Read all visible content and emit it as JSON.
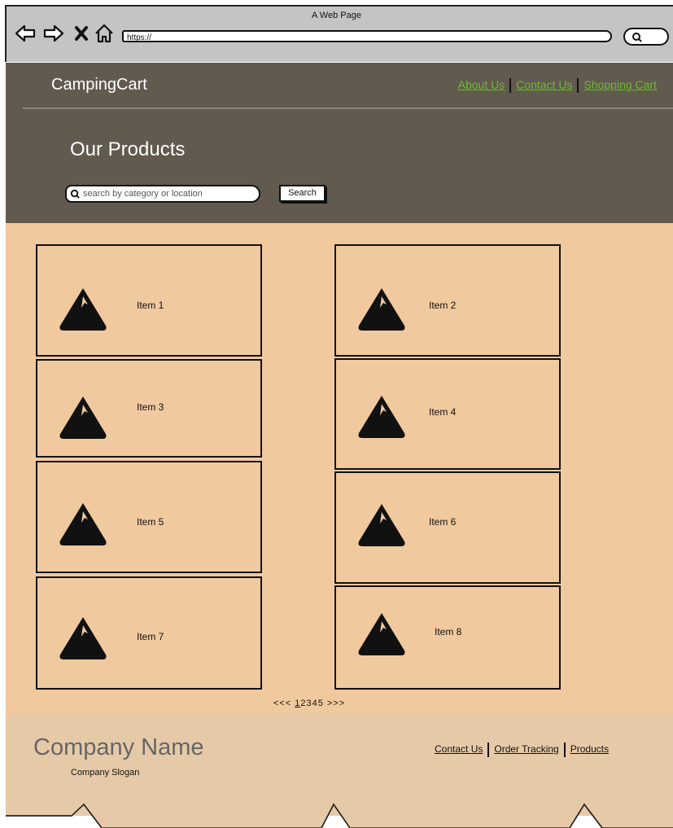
{
  "browser": {
    "window_title": "A Web Page",
    "url": "https://"
  },
  "header": {
    "brand": "CampingCart",
    "nav": [
      "About Us",
      "Contact Us",
      "Shopping Cart"
    ],
    "page_title": "Our Products",
    "search": {
      "placeholder": "search by category or location",
      "button_label": "Search"
    }
  },
  "products": [
    {
      "label": "Item 1"
    },
    {
      "label": "Item 2"
    },
    {
      "label": "Item 3"
    },
    {
      "label": "Item 4"
    },
    {
      "label": "Item 5"
    },
    {
      "label": "Item 6"
    },
    {
      "label": "Item 7"
    },
    {
      "label": "Item 8"
    }
  ],
  "pagination": {
    "prev": "<<<",
    "pages": [
      "1",
      "2",
      "3",
      "4",
      "5"
    ],
    "current": "1",
    "next": ">>>"
  },
  "footer": {
    "company_name": "Company Name",
    "slogan": "Company Slogan",
    "nav": [
      "Contact Us",
      "Order Tracking",
      "Products"
    ]
  },
  "icons": {
    "back": "back-arrow-icon",
    "forward": "forward-arrow-icon",
    "stop": "close-icon",
    "home": "home-icon",
    "search": "search-icon",
    "product_image": "mountain-image-icon"
  },
  "colors": {
    "header_bg": "#625a4f",
    "content_bg": "#f1c99e",
    "footer_bg": "#e6caa8",
    "link": "#6abd2c"
  }
}
